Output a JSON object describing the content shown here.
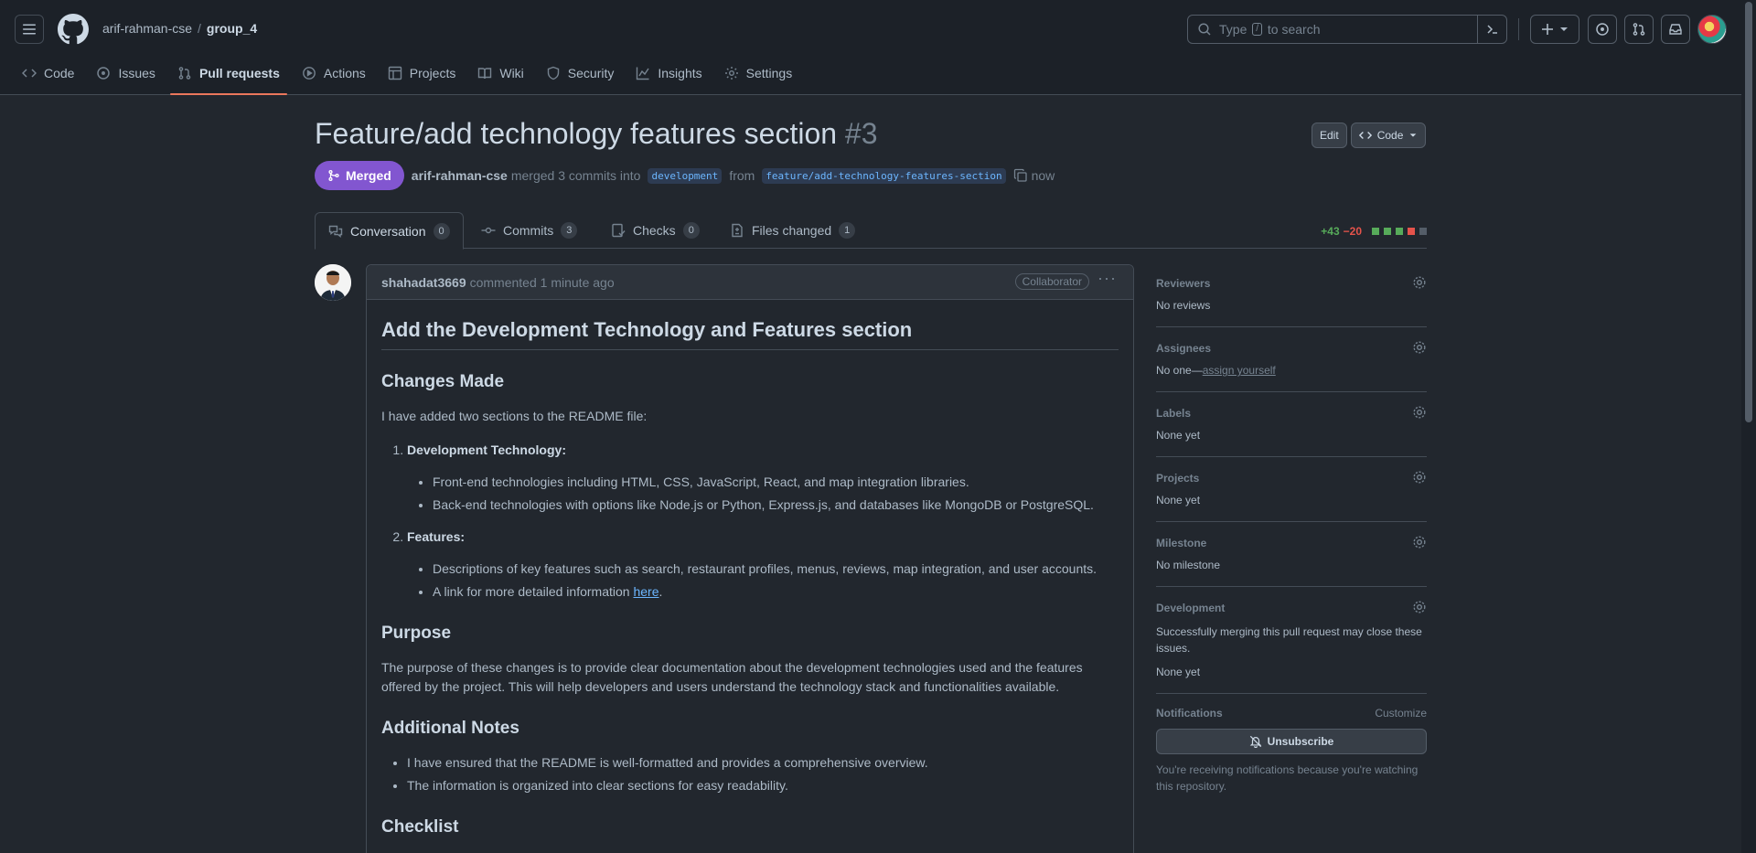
{
  "header": {
    "owner": "arif-rahman-cse",
    "separator": "/",
    "repo": "group_4",
    "search_prefix": "Type",
    "search_key": "/",
    "search_suffix": "to search"
  },
  "repo_nav": [
    {
      "label": "Code",
      "icon": "code-icon"
    },
    {
      "label": "Issues",
      "icon": "issue-opened-icon"
    },
    {
      "label": "Pull requests",
      "icon": "git-pull-request-icon",
      "active": true
    },
    {
      "label": "Actions",
      "icon": "play-icon"
    },
    {
      "label": "Projects",
      "icon": "table-icon"
    },
    {
      "label": "Wiki",
      "icon": "book-icon"
    },
    {
      "label": "Security",
      "icon": "shield-icon"
    },
    {
      "label": "Insights",
      "icon": "graph-icon"
    },
    {
      "label": "Settings",
      "icon": "gear-icon"
    }
  ],
  "pr": {
    "title": "Feature/add technology features section",
    "number": "#3",
    "edit_label": "Edit",
    "code_label": "Code",
    "status": "Merged",
    "author": "arif-rahman-cse",
    "merged_text": "merged 3 commits into",
    "base_branch": "development",
    "from_text": "from",
    "head_branch": "feature/add-technology-features-section",
    "time": "now"
  },
  "tabs": [
    {
      "label": "Conversation",
      "count": "0"
    },
    {
      "label": "Commits",
      "count": "3"
    },
    {
      "label": "Checks",
      "count": "0"
    },
    {
      "label": "Files changed",
      "count": "1"
    }
  ],
  "diffstat": {
    "additions": "+43",
    "deletions": "−20"
  },
  "comment": {
    "author": "shahadat3669",
    "action": "commented",
    "time": "1 minute ago",
    "badge": "Collaborator",
    "more": "···",
    "h1": "Add the Development Technology and Features section",
    "changes_heading": "Changes Made",
    "changes_intro": "I have added two sections to the README file:",
    "item1_title": "Development Technology:",
    "item1_a": "Front-end technologies including HTML, CSS, JavaScript, React, and map integration libraries.",
    "item1_b": "Back-end technologies with options like Node.js or Python, Express.js, and databases like MongoDB or PostgreSQL.",
    "item2_title": "Features:",
    "item2_a": "Descriptions of key features such as search, restaurant profiles, menus, reviews, map integration, and user accounts.",
    "item2_b_prefix": "A link for more detailed information",
    "item2_b_link": "here",
    "item2_b_suffix": ".",
    "purpose_heading": "Purpose",
    "purpose_text": "The purpose of these changes is to provide clear documentation about the development technologies used and the features offered by the project. This will help developers and users understand the technology stack and functionalities available.",
    "notes_heading": "Additional Notes",
    "note1": "I have ensured that the README is well-formatted and provides a comprehensive overview.",
    "note2": "The information is organized into clear sections for easy readability.",
    "checklist_heading": "Checklist"
  },
  "sidebar": {
    "reviewers_label": "Reviewers",
    "reviewers_value": "No reviews",
    "assignees_label": "Assignees",
    "assignees_value": "No one—",
    "assignees_link": "assign yourself",
    "labels_label": "Labels",
    "labels_value": "None yet",
    "projects_label": "Projects",
    "projects_value": "None yet",
    "milestone_label": "Milestone",
    "milestone_value": "No milestone",
    "development_label": "Development",
    "development_text": "Successfully merging this pull request may close these issues.",
    "development_value": "None yet",
    "notifications_label": "Notifications",
    "customize_label": "Customize",
    "unsubscribe_label": "Unsubscribe",
    "notifications_note": "You're receiving notifications because you're watching this repository."
  },
  "colors": {
    "merged": "#8256d0",
    "accent_underline": "#ec775c",
    "link": "#6cb6ff",
    "additions": "#57ab5a",
    "deletions": "#e5534b"
  }
}
